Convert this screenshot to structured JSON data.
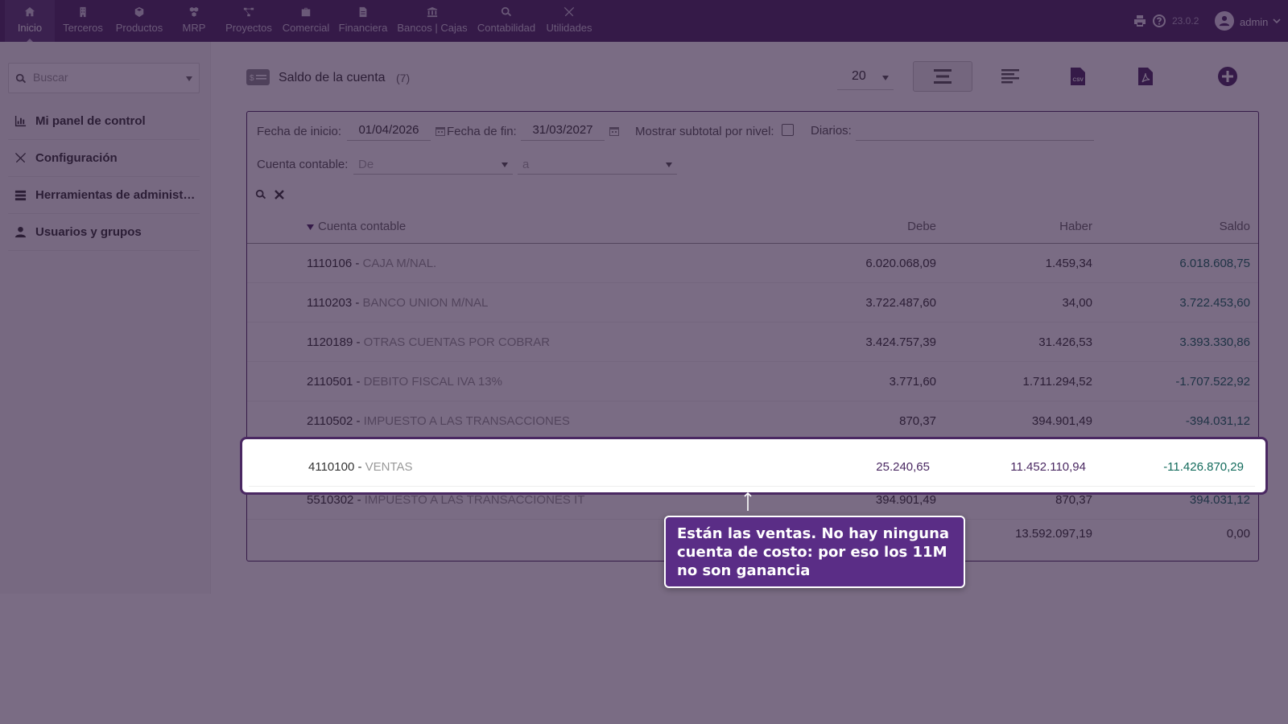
{
  "topnav": {
    "items": [
      {
        "label": "Inicio",
        "icon": "home-icon",
        "active": true
      },
      {
        "label": "Terceros",
        "icon": "building-icon"
      },
      {
        "label": "Productos",
        "icon": "cube-icon"
      },
      {
        "label": "MRP",
        "icon": "cubes-icon"
      },
      {
        "label": "Proyectos",
        "icon": "project-diagram-icon"
      },
      {
        "label": "Comercial",
        "icon": "suitcase-icon"
      },
      {
        "label": "Financiera",
        "icon": "file-invoice-icon"
      },
      {
        "label": "Bancos | Cajas",
        "icon": "bank-icon"
      },
      {
        "label": "Contabilidad",
        "icon": "search-dollar-icon"
      },
      {
        "label": "Utilidades",
        "icon": "tools-icon"
      }
    ],
    "version": "23.0.2",
    "user": "admin"
  },
  "sidebar": {
    "search_placeholder": "Buscar",
    "items": [
      {
        "label": "Mi panel de control",
        "icon": "chart-bar-icon"
      },
      {
        "label": "Configuración",
        "icon": "tools-icon"
      },
      {
        "label": "Herramientas de administ…",
        "icon": "server-icon"
      },
      {
        "label": "Usuarios y grupos",
        "icon": "user-icon"
      }
    ]
  },
  "page": {
    "title": "Saldo de la cuenta",
    "count": "(7)",
    "limit": "20"
  },
  "filters": {
    "start_label": "Fecha de inicio:",
    "start_value": "01/04/2026",
    "end_label": "Fecha de fin:",
    "end_value": "31/03/2027",
    "subtotal_label": "Mostrar subtotal por nivel:",
    "journals_label": "Diarios:",
    "account_label": "Cuenta contable:",
    "account_from_placeholder": "De",
    "account_to_placeholder": "a"
  },
  "table": {
    "headers": {
      "account": "Cuenta contable",
      "debit": "Debe",
      "credit": "Haber",
      "balance": "Saldo"
    },
    "rows": [
      {
        "code": "1110106",
        "name": "CAJA M/NAL.",
        "debit": "6.020.068,09",
        "credit": "1.459,34",
        "balance": "6.018.608,75"
      },
      {
        "code": "1110203",
        "name": "BANCO UNION M/NAL",
        "debit": "3.722.487,60",
        "credit": "34,00",
        "balance": "3.722.453,60"
      },
      {
        "code": "1120189",
        "name": "OTRAS CUENTAS POR COBRAR",
        "debit": "3.424.757,39",
        "credit": "31.426,53",
        "balance": "3.393.330,86"
      },
      {
        "code": "2110501",
        "name": "DEBITO FISCAL IVA 13%",
        "debit": "3.771,60",
        "credit": "1.711.294,52",
        "balance": "-1.707.522,92"
      },
      {
        "code": "2110502",
        "name": "IMPUESTO A LAS TRANSACCIONES",
        "debit": "870,37",
        "credit": "394.901,49",
        "balance": "-394.031,12"
      },
      {
        "code": "4110100",
        "name": "VENTAS",
        "debit": "25.240,65",
        "credit": "11.452.110,94",
        "balance": "-11.426.870,29"
      },
      {
        "code": "5510302",
        "name": "IMPUESTO A LAS TRANSACCIONES IT",
        "debit": "394.901,49",
        "credit": "870,37",
        "balance": "394.031,12"
      }
    ],
    "totals": {
      "credit": "13.592.097,19",
      "balance": "0,00"
    }
  },
  "tooltip": {
    "text": "Están las ventas. No hay ninguna cuenta de costo: por eso los 11M no son ganancia"
  },
  "colors": {
    "brand": "#4a2862",
    "balance_text": "#136b5c",
    "tooltip_bg": "#5a2d86"
  }
}
